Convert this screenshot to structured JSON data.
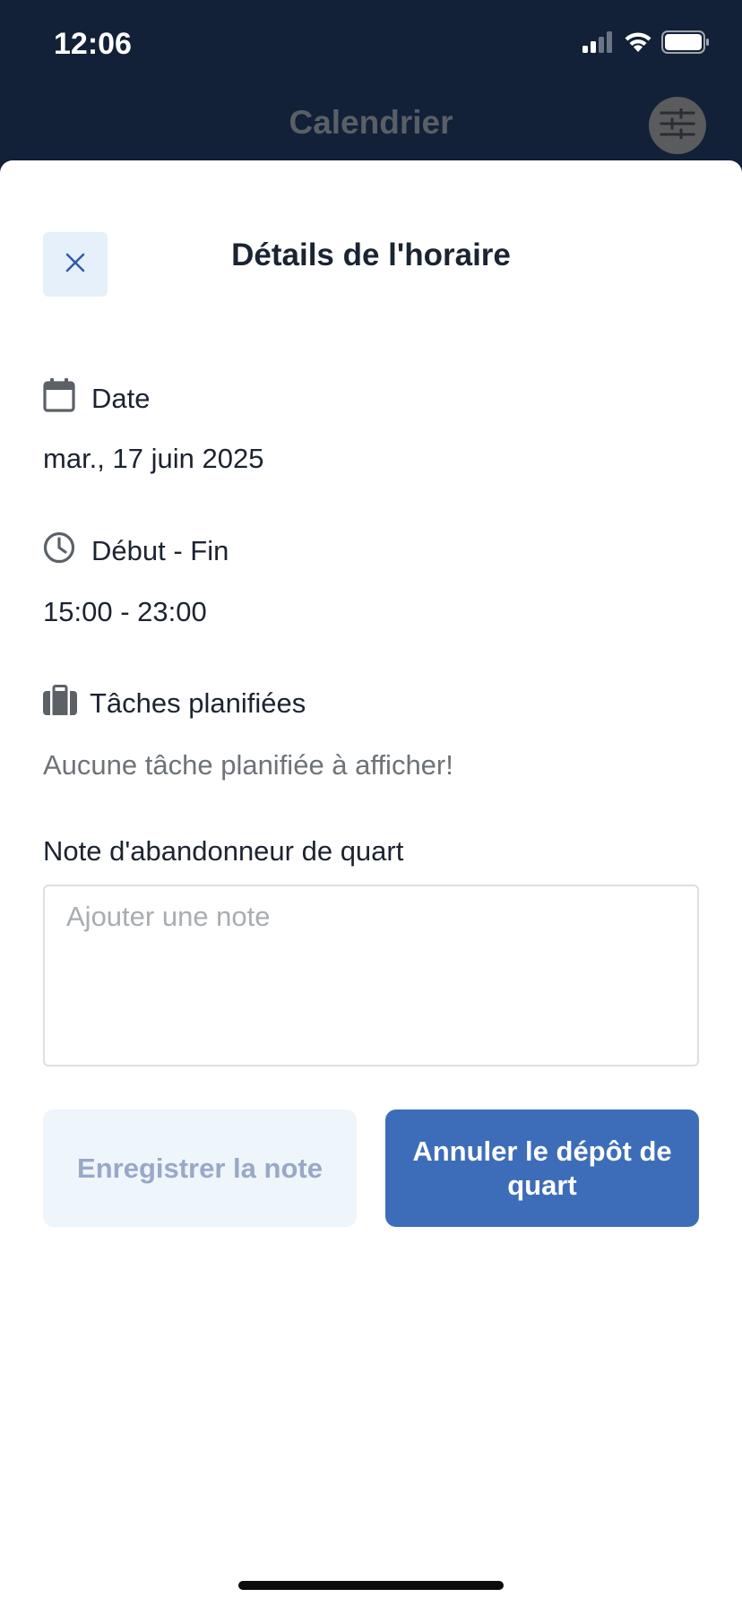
{
  "status_bar": {
    "time": "12:06",
    "icons": [
      "cellular-signal-icon",
      "wifi-icon",
      "battery-icon"
    ]
  },
  "nav": {
    "title": "Calendrier",
    "filter_icon": "sliders-icon"
  },
  "sheet": {
    "title": "Détails de l'horaire",
    "close_icon": "close-icon",
    "date": {
      "icon": "calendar-icon",
      "label": "Date",
      "value": "mar., 17 juin 2025"
    },
    "time_range": {
      "icon": "clock-icon",
      "label": "Début - Fin",
      "value": "15:00 - 23:00"
    },
    "tasks": {
      "icon": "briefcase-icon",
      "label": "Tâches planifiées",
      "empty_text": "Aucune tâche planifiée à afficher!"
    },
    "note": {
      "label": "Note d'abandonneur de quart",
      "placeholder": "Ajouter une note",
      "value": ""
    },
    "buttons": {
      "save_label": "Enregistrer la note",
      "cancel_drop_label": "Annuler le dépôt de quart"
    }
  },
  "colors": {
    "header_bg": "#122038",
    "primary": "#3d6db8",
    "primary_light": "#eef5fb",
    "close_bg": "#e6f0fb",
    "text": "#1c2331",
    "muted_text": "#6e7378"
  }
}
